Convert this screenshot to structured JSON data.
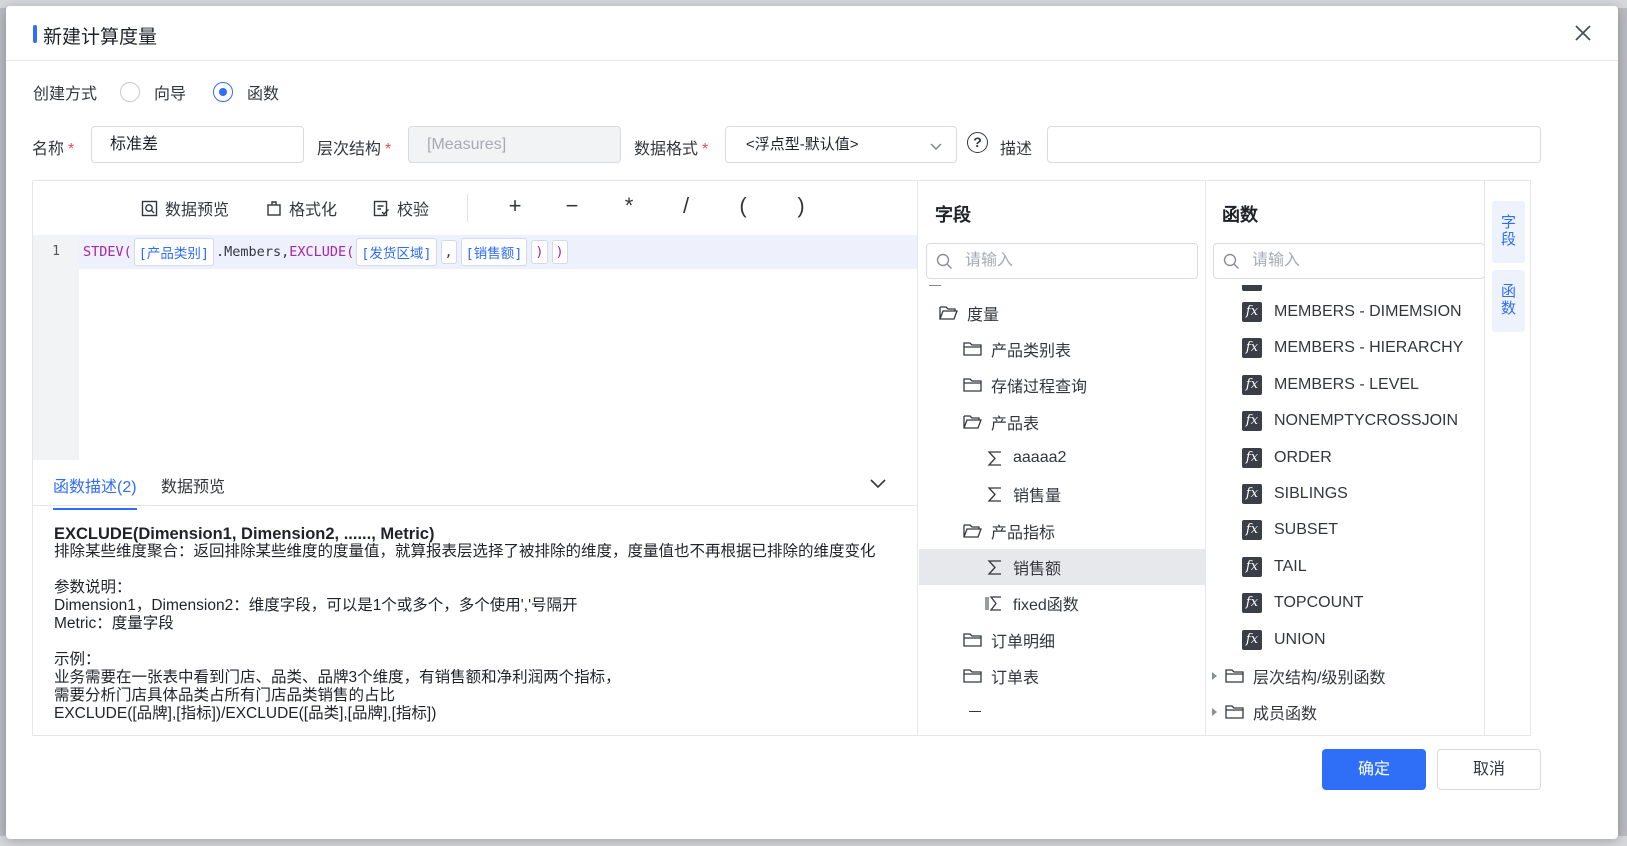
{
  "dialog": {
    "title": "新建计算度量",
    "close_icon": "close-icon"
  },
  "create_mode": {
    "label": "创建方式",
    "options": [
      {
        "label": "向导",
        "selected": false
      },
      {
        "label": "函数",
        "selected": true
      }
    ]
  },
  "fields": {
    "name_label": "名称",
    "name_value": "标准差",
    "hierarchy_label": "层次结构",
    "hierarchy_value": "[Measures]",
    "format_label": "数据格式",
    "format_value": "<浮点型-默认值>",
    "desc_label": "描述",
    "desc_value": "",
    "required_mark": "*"
  },
  "toolbar": {
    "preview": "数据预览",
    "format": "格式化",
    "validate": "校验",
    "ops": [
      "+",
      "−",
      "*",
      "/",
      "(",
      ")"
    ]
  },
  "editor": {
    "line_number": "1",
    "tokens": {
      "fn1": "STDEV(",
      "field1": "[产品类别]",
      "members": ".Members,",
      "fn2": "EXCLUDE(",
      "field2": "[发货区域]",
      "comma": ",",
      "field3": "[销售额]",
      "close1": ")",
      "close2": ")"
    }
  },
  "desc_tabs": {
    "tab1": "函数描述(2)",
    "tab2": "数据预览"
  },
  "description": {
    "signature": "EXCLUDE(Dimension1, Dimension2, ......, Metric)",
    "summary": "排除某些维度聚合：返回排除某些维度的度量值，就算报表层选择了被排除的维度，度量值也不再根据已排除的维度变化",
    "params_title": "参数说明：",
    "param1": "Dimension1，Dimension2：维度字段，可以是1个或多个，多个使用','号隔开",
    "param2": "Metric：度量字段",
    "example_title": "示例：",
    "example1": "业务需要在一张表中看到门店、品类、品牌3个维度，有销售额和净利润两个指标，",
    "example2": "需要分析门店具体品类占所有门店品类销售的占比",
    "example3": "EXCLUDE([品牌],[指标])/EXCLUDE([品类],[品牌],[指标])"
  },
  "fields_panel": {
    "title": "字段",
    "search_placeholder": "请输入",
    "items": [
      {
        "label": "度量",
        "kind": "folder-open"
      },
      {
        "label": "产品类别表",
        "kind": "folder"
      },
      {
        "label": "存储过程查询",
        "kind": "folder"
      },
      {
        "label": "产品表",
        "kind": "folder-open"
      },
      {
        "label": "aaaaa2",
        "kind": "sigma"
      },
      {
        "label": "销售量",
        "kind": "sigma"
      },
      {
        "label": "产品指标",
        "kind": "folder-open"
      },
      {
        "label": "销售额",
        "kind": "sigma",
        "selected": true
      },
      {
        "label": "fixed函数",
        "kind": "sigma-fixed"
      },
      {
        "label": "订单明细",
        "kind": "folder"
      },
      {
        "label": "订单表",
        "kind": "folder"
      }
    ]
  },
  "functions_panel": {
    "title": "函数",
    "search_placeholder": "请输入",
    "items": [
      "MEMBERS - DIMEMSION",
      "MEMBERS - HIERARCHY",
      "MEMBERS - LEVEL",
      "NONEMPTYCROSSJOIN",
      "ORDER",
      "SIBLINGS",
      "SUBSET",
      "TAIL",
      "TOPCOUNT",
      "UNION"
    ],
    "groups": [
      "层次结构/级别函数",
      "成员函数"
    ]
  },
  "side_tabs": {
    "fields": "字段",
    "functions": "函数"
  },
  "footer": {
    "confirm": "确定",
    "cancel": "取消"
  },
  "colors": {
    "primary": "#2f6ef6",
    "keyword": "#a626a4"
  }
}
